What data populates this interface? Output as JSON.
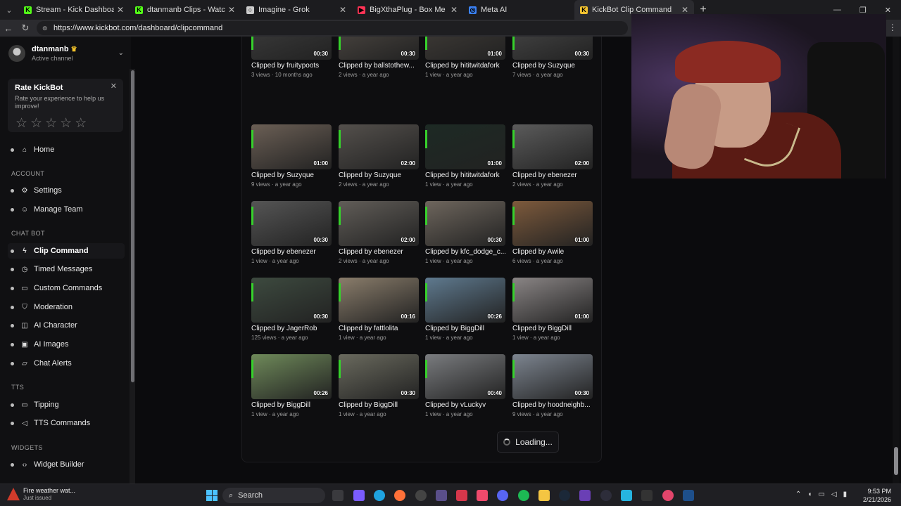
{
  "browser": {
    "tabs": [
      {
        "title": "Stream - Kick Dashboard",
        "favicon_color": "#53fc18",
        "favicon_glyph": "K"
      },
      {
        "title": "dtanmanb Clips - Watch Live on K",
        "favicon_color": "#53fc18",
        "favicon_glyph": "K"
      },
      {
        "title": "Imagine - Grok",
        "favicon_color": "#cccccc",
        "favicon_glyph": "○"
      },
      {
        "title": "BigXthaPlug - Box Me Up feat. Jel",
        "favicon_color": "#ff3355",
        "favicon_glyph": "▶"
      },
      {
        "title": "Meta AI",
        "favicon_color": "#3b82f6",
        "favicon_glyph": "◎"
      },
      {
        "title": "KickBot Clip Command",
        "favicon_color": "#f2c230",
        "favicon_glyph": "K",
        "active": true
      }
    ],
    "url": "https://www.kickbot.com/dashboard/clipcommand"
  },
  "sidebar": {
    "channel_name": "dtanmanb",
    "channel_status": "Active channel",
    "rate_card": {
      "title": "Rate KickBot",
      "subtitle": "Rate your experience to help us improve!",
      "stars": [
        "☆",
        "☆",
        "☆",
        "☆",
        "☆"
      ]
    },
    "home": "Home",
    "sections": {
      "account": "ACCOUNT",
      "chatbot": "CHAT BOT",
      "tts": "TTS",
      "widgets": "WIDGETS"
    },
    "items": {
      "settings": "Settings",
      "manage_team": "Manage Team",
      "clip_command": "Clip Command",
      "timed_messages": "Timed Messages",
      "custom_commands": "Custom Commands",
      "moderation": "Moderation",
      "ai_character": "AI Character",
      "ai_images": "AI Images",
      "chat_alerts": "Chat Alerts",
      "tipping": "Tipping",
      "tts_commands": "TTS Commands",
      "widget_builder": "Widget Builder"
    }
  },
  "clips": [
    {
      "title": "Clipped by fruitypoots",
      "meta": "3 views · 10 months ago",
      "duration": "00:30",
      "bg": "#3a3a3a"
    },
    {
      "title": "Clipped by ballstothew...",
      "meta": "2 views · a year ago",
      "duration": "00:30",
      "bg": "#4a4540"
    },
    {
      "title": "Clipped by hititwitdafork",
      "meta": "1 view · a year ago",
      "duration": "01:00",
      "bg": "#3e3a36"
    },
    {
      "title": "Clipped by Suzyque",
      "meta": "7 views · a year ago",
      "duration": "00:30",
      "bg": "#444444"
    },
    {
      "title": "Clipped by Suzyque",
      "meta": "9 views · a year ago",
      "duration": "01:00",
      "bg": "#6b5f55"
    },
    {
      "title": "Clipped by Suzyque",
      "meta": "2 views · a year ago",
      "duration": "02:00",
      "bg": "#54504c"
    },
    {
      "title": "Clipped by hititwitdafork",
      "meta": "1 view · a year ago",
      "duration": "01:00",
      "bg": "#1d2a24"
    },
    {
      "title": "Clipped by ebenezer",
      "meta": "2 views · a year ago",
      "duration": "02:00",
      "bg": "#5b5b5b"
    },
    {
      "title": "Clipped by ebenezer",
      "meta": "1 view · a year ago",
      "duration": "00:30",
      "bg": "#555555"
    },
    {
      "title": "Clipped by ebenezer",
      "meta": "2 views · a year ago",
      "duration": "02:00",
      "bg": "#615d58"
    },
    {
      "title": "Clipped by kfc_dodge_c...",
      "meta": "1 view · a year ago",
      "duration": "00:30",
      "bg": "#6e665d"
    },
    {
      "title": "Clipped by Awile",
      "meta": "6 views · a year ago",
      "duration": "01:00",
      "bg": "#7d5a3c"
    },
    {
      "title": "Clipped by JagerRob",
      "meta": "125 views · a year ago",
      "duration": "00:30",
      "bg": "#3d4a3f"
    },
    {
      "title": "Clipped by fattlolita",
      "meta": "1 view · a year ago",
      "duration": "00:16",
      "bg": "#8a7d6b"
    },
    {
      "title": "Clipped by BiggDill",
      "meta": "1 view · a year ago",
      "duration": "00:26",
      "bg": "#5f7a8f"
    },
    {
      "title": "Clipped by BiggDill",
      "meta": "1 view · a year ago",
      "duration": "01:00",
      "bg": "#8a8585"
    },
    {
      "title": "Clipped by BiggDill",
      "meta": "1 view · a year ago",
      "duration": "00:26",
      "bg": "#6f8a5a"
    },
    {
      "title": "Clipped by BiggDill",
      "meta": "1 view · a year ago",
      "duration": "00:30",
      "bg": "#6a6a5e"
    },
    {
      "title": "Clipped by vLuckyv",
      "meta": "1 view · a year ago",
      "duration": "00:40",
      "bg": "#7a7c7f"
    },
    {
      "title": "Clipped by hoodneighb...",
      "meta": "9 views · a year ago",
      "duration": "00:30",
      "bg": "#7d8590"
    }
  ],
  "loading_label": "Loading...",
  "taskbar": {
    "weather_title": "Fire weather wat...",
    "weather_sub": "Just issued",
    "search_placeholder": "Search",
    "time": "9:53 PM",
    "date": "2/21/2026"
  }
}
